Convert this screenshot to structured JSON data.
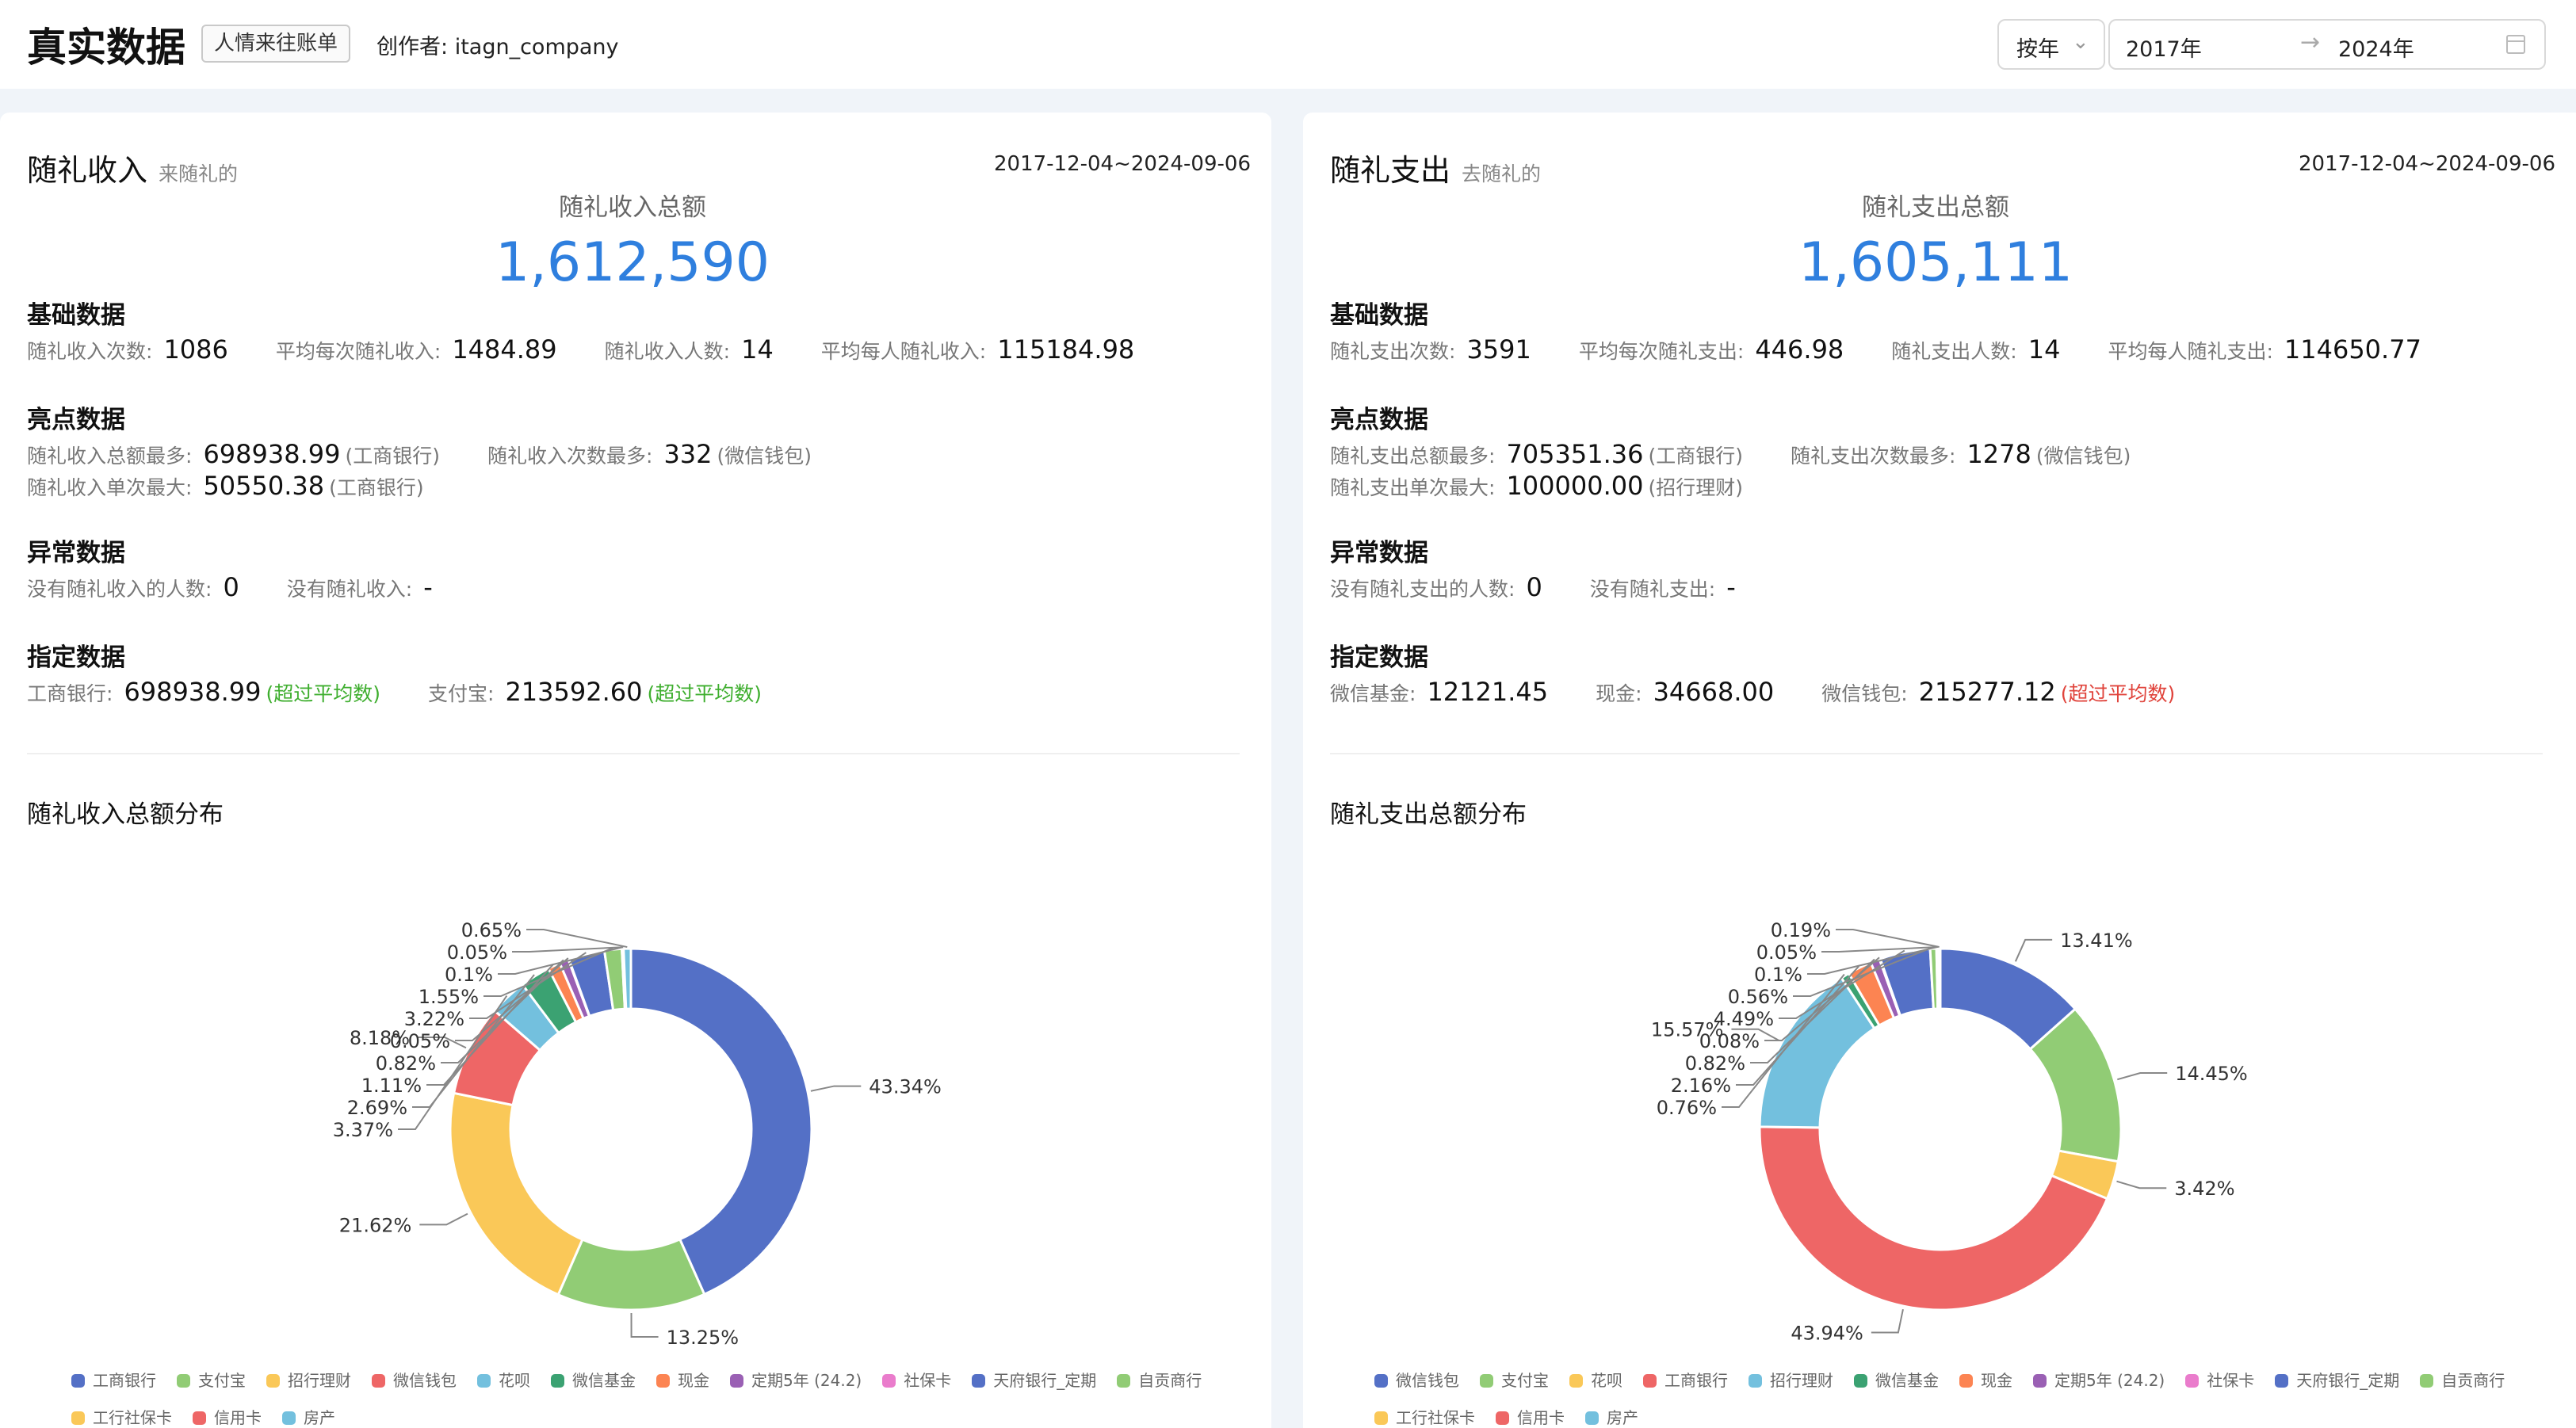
{
  "header": {
    "title": "真实数据",
    "tag": "人情来往账单",
    "creator_label": "创作者:",
    "creator_value": "itagn_company",
    "period_select": "按年",
    "range_start": "2017年",
    "range_end": "2024年"
  },
  "colors": [
    "#5470c6",
    "#91cc75",
    "#fac858",
    "#ee6666",
    "#73c0de",
    "#3ba272",
    "#fc8452",
    "#9a60b4",
    "#ea7ccc"
  ],
  "income": {
    "title": "随礼收入",
    "subtitle": "来随礼的",
    "date_range": "2017-12-04~2024-09-06",
    "total_label": "随礼收入总额",
    "total_value": "1,612,590",
    "basic_title": "基础数据",
    "basic": [
      {
        "label": "随礼收入次数:",
        "value": "1086"
      },
      {
        "label": "平均每次随礼收入:",
        "value": "1484.89"
      },
      {
        "label": "随礼收入人数:",
        "value": "14"
      },
      {
        "label": "平均每人随礼收入:",
        "value": "115184.98"
      }
    ],
    "highlight_title": "亮点数据",
    "highlight": [
      {
        "label": "随礼收入总额最多:",
        "value": "698938.99",
        "note": "(工商银行)"
      },
      {
        "label": "随礼收入次数最多:",
        "value": "332",
        "note": "(微信钱包)"
      },
      {
        "label": "随礼收入单次最大:",
        "value": "50550.38",
        "note": "(工商银行)"
      }
    ],
    "abnormal_title": "异常数据",
    "abnormal": [
      {
        "label": "没有随礼收入的人数:",
        "value": "0"
      },
      {
        "label": "没有随礼收入:",
        "value": "-"
      }
    ],
    "specified_title": "指定数据",
    "specified": [
      {
        "label": "工商银行:",
        "value": "698938.99",
        "note": "(超过平均数)"
      },
      {
        "label": "支付宝:",
        "value": "213592.60",
        "note": "(超过平均数)"
      }
    ],
    "chart_title": "随礼收入总额分布",
    "legend": [
      "工商银行",
      "支付宝",
      "招行理财",
      "微信钱包",
      "花呗",
      "微信基金",
      "现金",
      "定期5年 (24.2)",
      "社保卡",
      "天府银行_定期",
      "自贡商行",
      "工行社保卡",
      "信用卡",
      "房产"
    ]
  },
  "expense": {
    "title": "随礼支出",
    "subtitle": "去随礼的",
    "date_range": "2017-12-04~2024-09-06",
    "total_label": "随礼支出总额",
    "total_value": "1,605,111",
    "basic_title": "基础数据",
    "basic": [
      {
        "label": "随礼支出次数:",
        "value": "3591"
      },
      {
        "label": "平均每次随礼支出:",
        "value": "446.98"
      },
      {
        "label": "随礼支出人数:",
        "value": "14"
      },
      {
        "label": "平均每人随礼支出:",
        "value": "114650.77"
      }
    ],
    "highlight_title": "亮点数据",
    "highlight": [
      {
        "label": "随礼支出总额最多:",
        "value": "705351.36",
        "note": "(工商银行)"
      },
      {
        "label": "随礼支出次数最多:",
        "value": "1278",
        "note": "(微信钱包)"
      },
      {
        "label": "随礼支出单次最大:",
        "value": "100000.00",
        "note": "(招行理财)"
      }
    ],
    "abnormal_title": "异常数据",
    "abnormal": [
      {
        "label": "没有随礼支出的人数:",
        "value": "0"
      },
      {
        "label": "没有随礼支出:",
        "value": "-"
      }
    ],
    "specified_title": "指定数据",
    "specified": [
      {
        "label": "微信基金:",
        "value": "12121.45",
        "note": ""
      },
      {
        "label": "现金:",
        "value": "34668.00",
        "note": ""
      },
      {
        "label": "微信钱包:",
        "value": "215277.12",
        "note": "(超过平均数)"
      }
    ],
    "chart_title": "随礼支出总额分布",
    "legend": [
      "微信钱包",
      "支付宝",
      "花呗",
      "工商银行",
      "招行理财",
      "微信基金",
      "现金",
      "定期5年 (24.2)",
      "社保卡",
      "天府银行_定期",
      "自贡商行",
      "工行社保卡",
      "信用卡",
      "房产"
    ]
  },
  "chart_data": [
    {
      "type": "pie",
      "title": "随礼收入总额分布",
      "categories": [
        "工商银行",
        "支付宝",
        "招行理财",
        "微信钱包",
        "花呗",
        "微信基金",
        "现金",
        "定期5年 (24.2)",
        "社保卡",
        "天府银行_定期",
        "自贡商行",
        "工行社保卡",
        "信用卡",
        "房产"
      ],
      "values": [
        43.34,
        13.25,
        21.62,
        8.18,
        3.37,
        2.69,
        1.11,
        0.82,
        0.05,
        3.22,
        1.55,
        0.1,
        0.05,
        0.65
      ],
      "labels": [
        "43.34%",
        "13.25%",
        "21.62%",
        "8.18%",
        "3.37%",
        "2.69%",
        "1.11%",
        "0.82%",
        "0.05%",
        "3.22%",
        "1.55%",
        "0.1%",
        "0.05%",
        "0.65%"
      ]
    },
    {
      "type": "pie",
      "title": "随礼支出总额分布",
      "categories": [
        "微信钱包",
        "支付宝",
        "花呗",
        "工商银行",
        "招行理财",
        "微信基金",
        "现金",
        "定期5年 (24.2)",
        "社保卡",
        "天府银行_定期",
        "自贡商行",
        "工行社保卡",
        "信用卡",
        "房产"
      ],
      "values": [
        13.41,
        14.45,
        3.42,
        43.94,
        15.57,
        0.76,
        2.16,
        0.82,
        0.08,
        4.49,
        0.56,
        0.1,
        0.05,
        0.19
      ],
      "labels": [
        "13.41%",
        "14.45%",
        "3.42%",
        "43.94%",
        "15.57%",
        "0.76%",
        "2.16%",
        "0.82%",
        "0.08%",
        "4.49%",
        "0.56%",
        "0.1%",
        "0.05%",
        "0.19%"
      ]
    }
  ]
}
